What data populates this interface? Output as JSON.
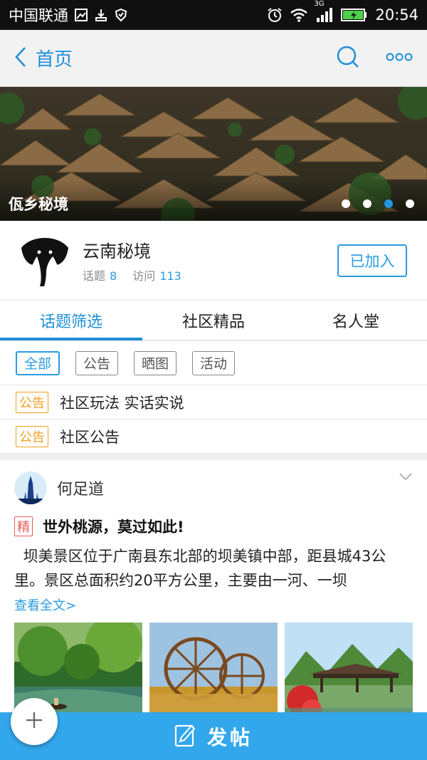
{
  "status_bar": {
    "carrier": "中国联通",
    "network": "3G",
    "time": "20:54"
  },
  "nav": {
    "back_label": "首页",
    "icons": [
      "back-chevron-icon",
      "search-icon",
      "more-icon"
    ]
  },
  "banner": {
    "title": "佤乡秘境",
    "slide_count": 4,
    "active_slide_index": 2
  },
  "community": {
    "name": "云南秘境",
    "topics_label": "话题",
    "topics_count": "8",
    "visits_label": "访问",
    "visits_count": "113",
    "join_label": "已加入"
  },
  "tabs": [
    {
      "label": "话题筛选",
      "active": true
    },
    {
      "label": "社区精品",
      "active": false
    },
    {
      "label": "名人堂",
      "active": false
    }
  ],
  "filters": [
    {
      "label": "全部",
      "active": true
    },
    {
      "label": "公告",
      "active": false
    },
    {
      "label": "晒图",
      "active": false
    },
    {
      "label": "活动",
      "active": false
    }
  ],
  "notices": [
    {
      "tag": "公告",
      "text": "社区玩法 实话实说"
    },
    {
      "tag": "公告",
      "text": "社区公告"
    }
  ],
  "post": {
    "author": "何足道",
    "badge": "精",
    "title": "世外桃源，莫过如此!",
    "body": "坝美景区位于广南县东北部的坝美镇中部，距县城43公里。景区总面积约20平方公里，主要由一河、一坝",
    "read_more": "查看全文>"
  },
  "bottom_bar": {
    "label": "发帖"
  },
  "colors": {
    "accent": "#1e8fd8",
    "notice_tag": "#f0a020",
    "badge_red": "#e85d5d",
    "bottom_bar": "#33a7ec"
  }
}
